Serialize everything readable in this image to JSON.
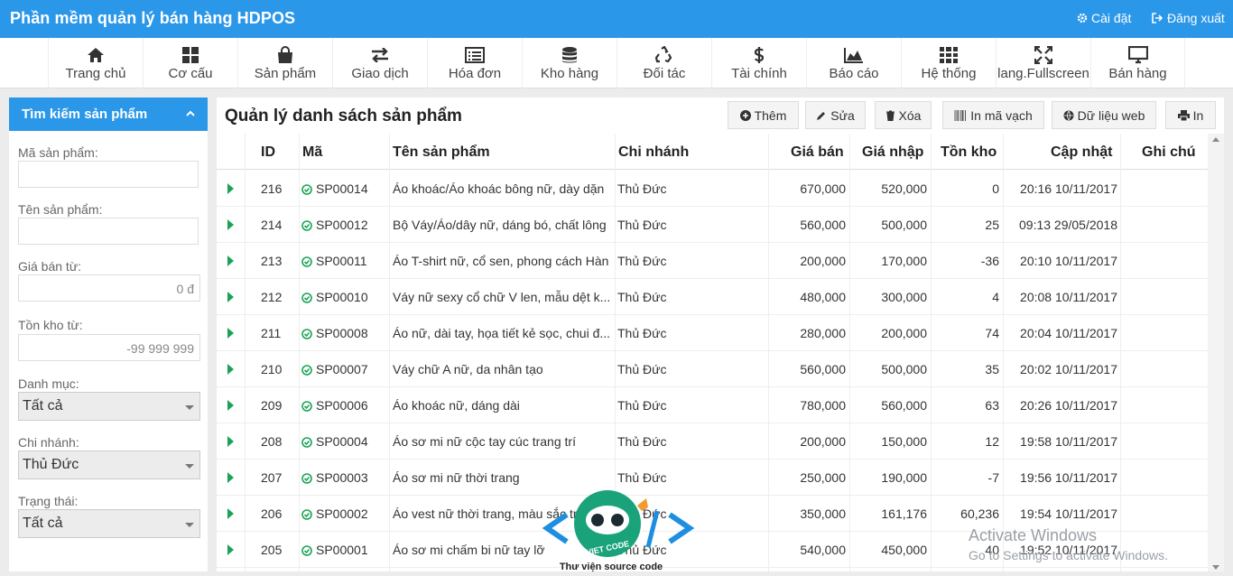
{
  "app": {
    "title": "Phần mềm quản lý bán hàng HDPOS",
    "settings_label": "Cài đặt",
    "logout_label": "Đăng xuất"
  },
  "menu": [
    {
      "label": "Trang chủ",
      "icon": "home-icon"
    },
    {
      "label": "Cơ cấu",
      "icon": "grid-icon"
    },
    {
      "label": "Sản phẩm",
      "icon": "shopping-bag-icon"
    },
    {
      "label": "Giao dịch",
      "icon": "exchange-icon"
    },
    {
      "label": "Hóa đơn",
      "icon": "list-icon"
    },
    {
      "label": "Kho hàng",
      "icon": "database-icon"
    },
    {
      "label": "Đối tác",
      "icon": "recycle-icon"
    },
    {
      "label": "Tài chính",
      "icon": "dollar-icon"
    },
    {
      "label": "Báo cáo",
      "icon": "area-chart-icon"
    },
    {
      "label": "Hệ thống",
      "icon": "th-icon"
    },
    {
      "label": "lang.Fullscreen",
      "icon": "fullscreen-icon"
    },
    {
      "label": "Bán hàng",
      "icon": "desktop-icon"
    }
  ],
  "sidebar": {
    "title": "Tìm kiếm sản phẩm",
    "code_label": "Mã sản phẩm:",
    "code_value": "",
    "name_label": "Tên sản phẩm:",
    "name_value": "",
    "price_label": "Giá bán từ:",
    "price_value": "0 đ",
    "stock_label": "Tồn kho từ:",
    "stock_value": "-99 999 999",
    "category_label": "Danh mục:",
    "category_value": "Tất cả",
    "branch_label": "Chi nhánh:",
    "branch_value": "Thủ Đức",
    "status_label": "Trạng thái:",
    "status_value": "Tất cả"
  },
  "main": {
    "title": "Quản lý danh sách sản phẩm",
    "buttons": {
      "add": "Thêm",
      "edit": "Sửa",
      "delete": "Xóa",
      "barcode": "In mã vạch",
      "web": "Dữ liệu web",
      "print": "In"
    },
    "columns": {
      "id": "ID",
      "code": "Mã",
      "name": "Tên sản phẩm",
      "branch": "Chi nhánh",
      "price": "Giá bán",
      "cost": "Giá nhập",
      "stock": "Tồn kho",
      "updated": "Cập nhật",
      "note": "Ghi chú"
    },
    "rows": [
      {
        "id": "216",
        "code": "SP00014",
        "name": "Áo khoác/Áo khoác bông nữ, dày dặn",
        "branch": "Thủ Đức",
        "price": "670,000",
        "cost": "520,000",
        "stock": "0",
        "updated": "20:16 10/11/2017",
        "note": ""
      },
      {
        "id": "214",
        "code": "SP00012",
        "name": "Bộ Váy/Áo/dây nữ, dáng bó, chất lông",
        "branch": "Thủ Đức",
        "price": "560,000",
        "cost": "500,000",
        "stock": "25",
        "updated": "09:13 29/05/2018",
        "note": ""
      },
      {
        "id": "213",
        "code": "SP00011",
        "name": "Áo T-shirt nữ, cổ sen, phong cách Hàn",
        "branch": "Thủ Đức",
        "price": "200,000",
        "cost": "170,000",
        "stock": "-36",
        "updated": "20:10 10/11/2017",
        "note": ""
      },
      {
        "id": "212",
        "code": "SP00010",
        "name": "Váy nữ sexy cổ chữ V len, mẫu dệt k...",
        "branch": "Thủ Đức",
        "price": "480,000",
        "cost": "300,000",
        "stock": "4",
        "updated": "20:08 10/11/2017",
        "note": ""
      },
      {
        "id": "211",
        "code": "SP00008",
        "name": "Áo nữ, dài tay, họa tiết kẻ sọc, chui đ...",
        "branch": "Thủ Đức",
        "price": "280,000",
        "cost": "200,000",
        "stock": "74",
        "updated": "20:04 10/11/2017",
        "note": ""
      },
      {
        "id": "210",
        "code": "SP00007",
        "name": "Váy chữ A nữ, da nhân tạo",
        "branch": "Thủ Đức",
        "price": "560,000",
        "cost": "500,000",
        "stock": "35",
        "updated": "20:02 10/11/2017",
        "note": ""
      },
      {
        "id": "209",
        "code": "SP00006",
        "name": "Áo khoác nữ, dáng dài",
        "branch": "Thủ Đức",
        "price": "780,000",
        "cost": "560,000",
        "stock": "63",
        "updated": "20:26 10/11/2017",
        "note": ""
      },
      {
        "id": "208",
        "code": "SP00004",
        "name": "Áo sơ mi nữ cộc tay cúc trang trí",
        "branch": "Thủ Đức",
        "price": "200,000",
        "cost": "150,000",
        "stock": "12",
        "updated": "19:58 10/11/2017",
        "note": ""
      },
      {
        "id": "207",
        "code": "SP00003",
        "name": "Áo sơ mi nữ thời trang",
        "branch": "Thủ Đức",
        "price": "250,000",
        "cost": "190,000",
        "stock": "-7",
        "updated": "19:56 10/11/2017",
        "note": ""
      },
      {
        "id": "206",
        "code": "SP00002",
        "name": "Áo vest nữ thời trang, màu sắc tr",
        "branch": "Thủ Đức",
        "price": "350,000",
        "cost": "161,176",
        "stock": "60,236",
        "updated": "19:54 10/11/2017",
        "note": ""
      },
      {
        "id": "205",
        "code": "SP00001",
        "name": "Áo sơ mi chấm bi nữ tay lỡ",
        "branch": "Thủ Đức",
        "price": "540,000",
        "cost": "450,000",
        "stock": "40",
        "updated": "19:52 10/11/2017",
        "note": ""
      }
    ]
  },
  "watermark": {
    "activate_title": "Activate Windows",
    "activate_sub": "Go to Settings to activate Windows.",
    "logo_text": "VIET CODE",
    "logo_caption": "Thư viện source code"
  },
  "colors": {
    "primary": "#2b97e8",
    "check": "#1aa356",
    "expander": "#1aa356"
  }
}
